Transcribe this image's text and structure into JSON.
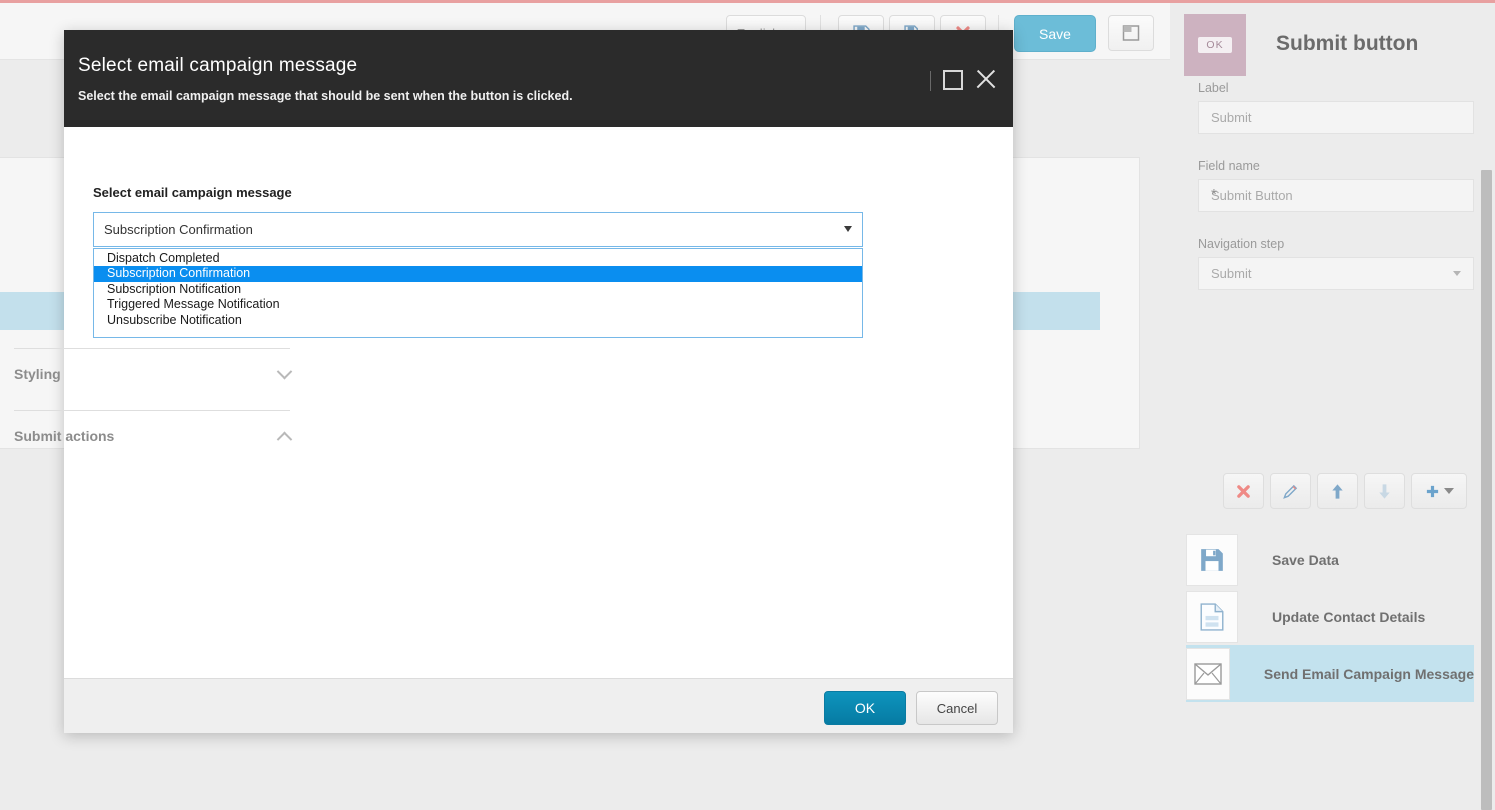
{
  "app": {
    "toolbar": {
      "language_label": "English",
      "save_icon": "save-icon",
      "save_as_icon": "save-as-icon",
      "delete_icon": "delete-icon",
      "save_label": "Save",
      "panel_icon": "panel-toggle-icon"
    }
  },
  "modal": {
    "title": "Select email campaign message",
    "subtitle": "Select the email campaign message that should be sent when the button is clicked.",
    "maximize_icon": "maximize-icon",
    "close_icon": "close-icon",
    "field": {
      "label": "Select email campaign message",
      "selected": "Subscription Confirmation",
      "dropdown_icon": "chevron-down-icon",
      "options": [
        "Dispatch Completed",
        "Subscription Confirmation",
        "Subscription Notification",
        "Triggered Message Notification",
        "Unsubscribe Notification"
      ],
      "selected_index": 1
    },
    "footer": {
      "ok_label": "OK",
      "cancel_label": "Cancel"
    }
  },
  "sidebar": {
    "thumbnail_badge": "OK",
    "title": "Submit button",
    "fields": [
      {
        "label": "Label",
        "value": "Submit",
        "required": false,
        "type": "text"
      },
      {
        "label": "Field name",
        "value": "Submit Button",
        "required": true,
        "type": "text"
      },
      {
        "label": "Navigation step",
        "value": "Submit",
        "required": false,
        "type": "select"
      }
    ],
    "required_marker": "*",
    "sections": [
      {
        "title": "Styling",
        "state": "collapsed",
        "icon": "chevron-down-icon"
      },
      {
        "title": "Submit actions",
        "state": "expanded",
        "icon": "chevron-up-icon"
      }
    ],
    "action_toolbar": [
      {
        "name": "delete-action-button",
        "icon": "delete-icon",
        "enabled": true
      },
      {
        "name": "edit-action-button",
        "icon": "pencil-icon",
        "enabled": true
      },
      {
        "name": "move-up-action-button",
        "icon": "arrow-up-icon",
        "enabled": true
      },
      {
        "name": "move-down-action-button",
        "icon": "arrow-down-icon",
        "enabled": false
      },
      {
        "name": "add-action-button",
        "icon": "plus-icon",
        "enabled": true
      }
    ],
    "actions": [
      {
        "label": "Save Data",
        "icon": "floppy-disk-icon",
        "selected": false
      },
      {
        "label": "Update Contact Details",
        "icon": "document-icon",
        "selected": false
      },
      {
        "label": "Send Email Campaign Message",
        "icon": "envelope-icon",
        "selected": true
      }
    ]
  },
  "colors": {
    "accent_blue": "#0a8ef0",
    "ok_button": "#0e94bd",
    "modal_header": "#2b2b2b",
    "selection_highlight": "#c3e2ee",
    "top_rule": "#e8a0a0",
    "thumbnail": "#cdb2c0"
  }
}
